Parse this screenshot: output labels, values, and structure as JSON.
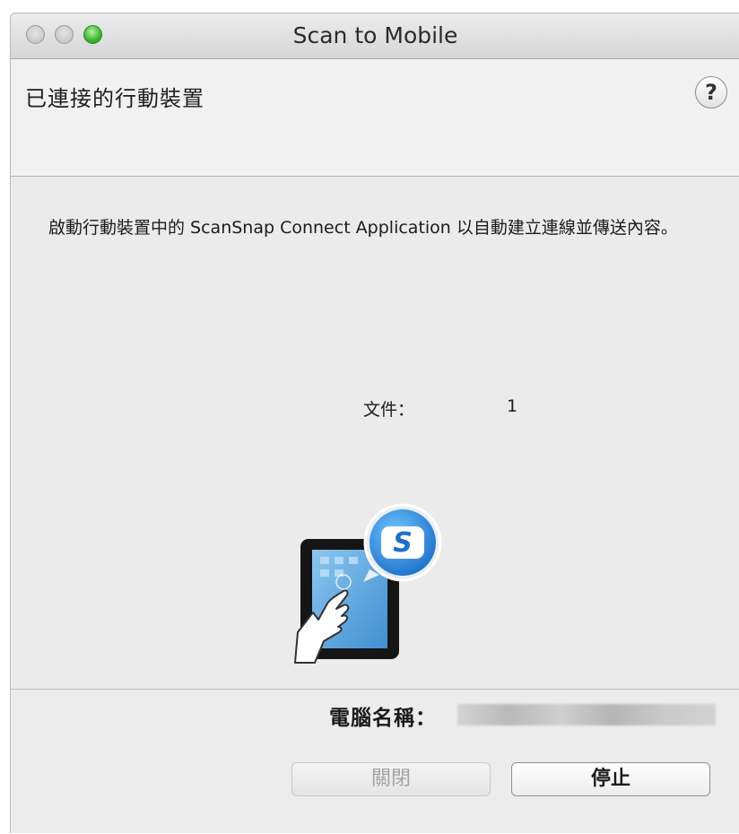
{
  "window": {
    "title": "Scan to Mobile"
  },
  "header": {
    "title": "已連接的行動裝置",
    "help_label": "?"
  },
  "main": {
    "instructions": "啟動行動裝置中的 ScanSnap Connect Application 以自動建立連線並傳送內容。",
    "files_label": "文件：",
    "files_value": "1"
  },
  "footer": {
    "computer_name_label": "電腦名稱：",
    "computer_name_value": "",
    "close_button_label": "關閉",
    "stop_button_label": "停止"
  },
  "colors": {
    "zoom_button": "#38b530",
    "window_background": "#ececec",
    "disabled_text": "#a3a3a3"
  },
  "icons": [
    "close-window-icon",
    "minimize-window-icon",
    "zoom-window-icon",
    "help-icon",
    "scansnap-tablet-icon"
  ]
}
